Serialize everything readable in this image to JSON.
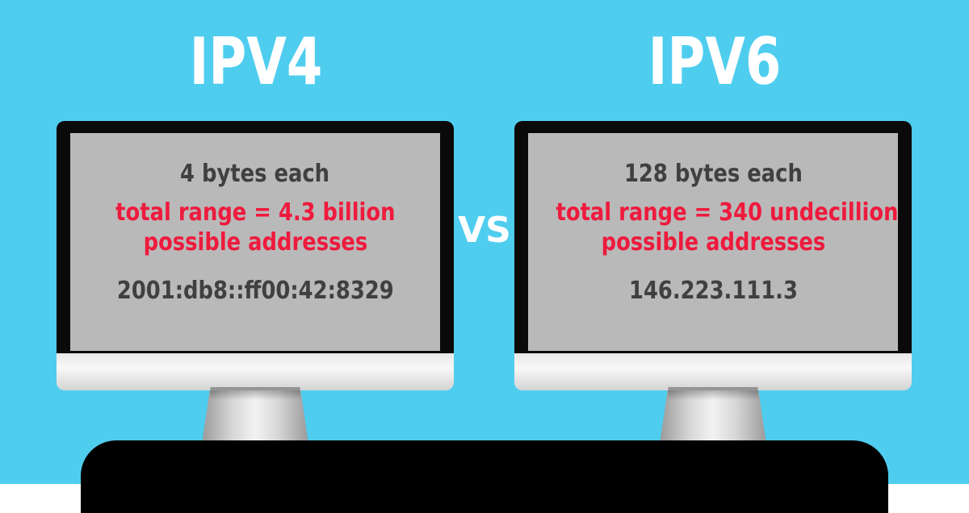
{
  "colors": {
    "background": "#4fcdef",
    "title_text": "#ffffff",
    "screen": "#b9b9b9",
    "bezel": "#0a0a0a",
    "highlight_text": "#ee1a3d",
    "body_text": "#404040",
    "desk": "#000000"
  },
  "left": {
    "title": "IPV4",
    "line1": "4 bytes each",
    "line2": "total range = 4.3 billion",
    "line3": "possible addresses",
    "line4": "2001:db8::ff00:42:8329"
  },
  "vs": "VS",
  "right": {
    "title": "IPV6",
    "line1": "128 bytes each",
    "line2": "total range = 340 undecillion",
    "line3": "possible addresses",
    "line4": "146.223.111.3"
  }
}
